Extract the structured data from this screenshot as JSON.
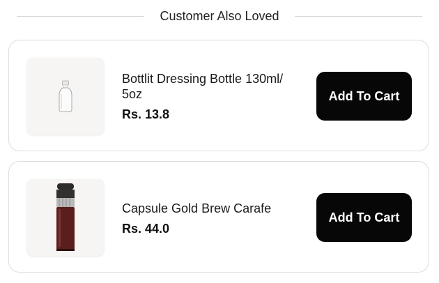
{
  "section": {
    "title": "Customer Also Loved"
  },
  "products": [
    {
      "name": "Bottlit Dressing Bottle 130ml/ 5oz",
      "price": "Rs. 13.8",
      "button_label": "Add To Cart",
      "image": "glass-bottle-image"
    },
    {
      "name": "Capsule Gold Brew Carafe",
      "price": "Rs. 44.0",
      "button_label": "Add To Cart",
      "image": "brew-carafe-image"
    }
  ],
  "colors": {
    "button_bg": "#070707",
    "button_text": "#ffffff",
    "border": "#dcdcdc",
    "divider": "#d6d6d6",
    "carafe_body": "#5a1e1c"
  }
}
